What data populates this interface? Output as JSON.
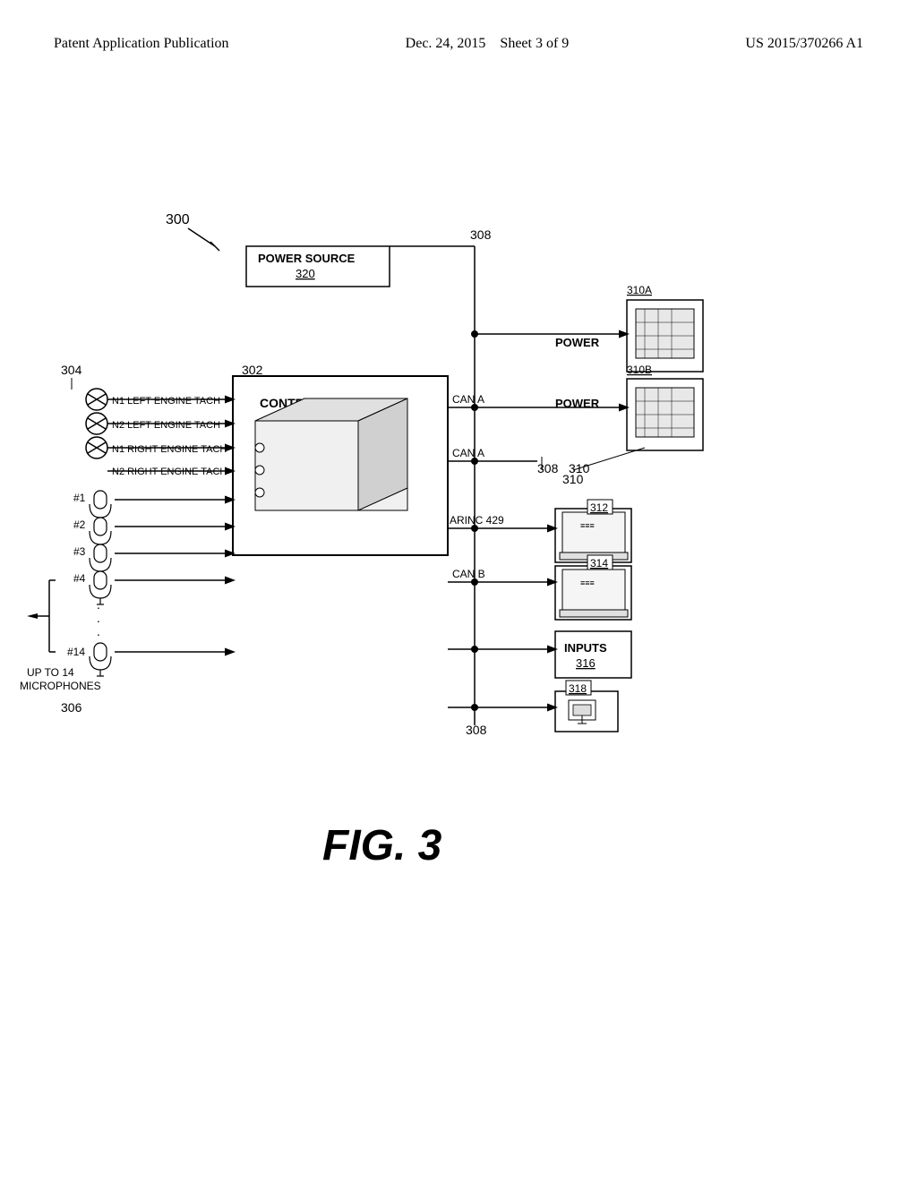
{
  "header": {
    "left": "Patent Application Publication",
    "center_date": "Dec. 24, 2015",
    "center_sheet": "Sheet 3 of 9",
    "right": "US 2015/370266 A1"
  },
  "figure": {
    "label": "FIG. 3",
    "number": "300",
    "ref_300": "300",
    "ref_302": "302",
    "ref_304": "304",
    "ref_306": "306",
    "ref_308": "308",
    "ref_310": "310",
    "ref_310A": "310A",
    "ref_310B": "310B",
    "ref_312": "312",
    "ref_314": "314",
    "ref_316": "316",
    "ref_318": "318",
    "ref_320": "320",
    "power_source_label": "POWER SOURCE",
    "power_source_ref": "320",
    "controller_label": "CONTROLLER",
    "power_label_a": "POWER",
    "power_label_b": "POWER",
    "can_a_label1": "CAN A",
    "can_a_label2": "CAN A",
    "arinc_label": "ARINC 429",
    "can_b_label": "CAN B",
    "inputs_label": "INPUTS",
    "inputs_ref": "316",
    "n1_left": "N1 LEFT ENGINE TACH",
    "n2_left": "N2 LEFT ENGINE TACH",
    "n1_right": "N1 RIGHT ENGINE TACH",
    "n2_right": "N2 RIGHT ENGINE TACH",
    "mic1": "#1",
    "mic2": "#2",
    "mic3": "#3",
    "mic4": "#4",
    "mic14": "#14",
    "up_to_14": "UP TO 14",
    "microphones": "MICROPHONES"
  }
}
